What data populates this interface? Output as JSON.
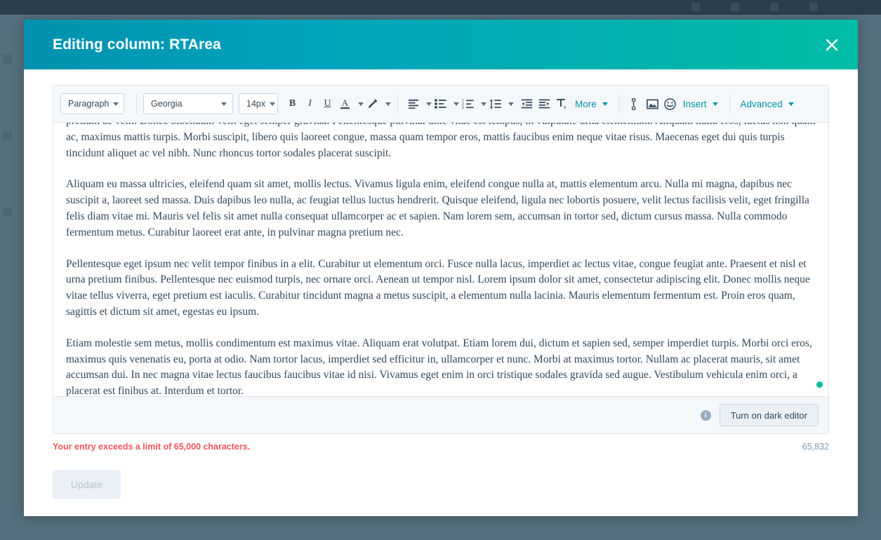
{
  "modal": {
    "title": "Editing column: RTArea",
    "close_label": "close-icon"
  },
  "toolbar": {
    "block_format": "Paragraph",
    "font_family": "Georgia",
    "font_size": "14px",
    "bold": "B",
    "italic": "I",
    "underline": "U",
    "text_color": "A",
    "more": "More",
    "insert": "Insert",
    "advanced": "Advanced",
    "icons": {
      "text_color": "text-color-icon",
      "highlight": "highlight-pen-icon",
      "align": "align-left-icon",
      "bullet_list": "bulleted-list-icon",
      "numbered_list": "numbered-list-icon",
      "line_height": "line-height-icon",
      "outdent": "outdent-icon",
      "indent": "indent-icon",
      "clear_format": "clear-formatting-icon",
      "link": "link-icon",
      "image": "image-icon",
      "emoji": "emoji-icon"
    }
  },
  "document": {
    "paragraphs": [
      "pretium ac velit. Donec bibendum velit eget semper gravida. Pellentesque pulvinar ante vitae est tempus, in vulputate urna elementum. Aliquam nulla eros, luctus non quam ac, maximus mattis turpis. Morbi suscipit, libero quis laoreet congue, massa quam tempor eros, mattis faucibus enim neque vitae risus. Maecenas eget dui quis turpis tincidunt aliquet ac vel nibh. Nunc rhoncus tortor sodales placerat suscipit.",
      "Aliquam eu massa ultricies, eleifend quam sit amet, mollis lectus. Vivamus ligula enim, eleifend congue nulla at, mattis elementum arcu. Nulla mi magna, dapibus nec suscipit a, laoreet sed massa. Duis dapibus leo nulla, ac feugiat tellus luctus hendrerit. Quisque eleifend, ligula nec lobortis posuere, velit lectus facilisis velit, eget fringilla felis diam vitae mi. Mauris vel felis sit amet nulla consequat ullamcorper ac et sapien. Nam lorem sem, accumsan in tortor sed, dictum cursus massa. Nulla commodo fermentum metus. Curabitur laoreet erat ante, in pulvinar magna pretium nec.",
      "Pellentesque eget ipsum nec velit tempor finibus in a elit. Curabitur ut elementum orci. Fusce nulla lacus, imperdiet ac lectus vitae, congue feugiat ante. Praesent et nisl et urna pretium finibus. Pellentesque nec euismod turpis, nec ornare orci. Aenean ut tempor nisl. Lorem ipsum dolor sit amet, consectetur adipiscing elit. Donec mollis neque vitae tellus viverra, eget pretium est iaculis. Curabitur tincidunt magna a metus suscipit, a elementum nulla lacinia. Mauris elementum fermentum est. Proin eros quam, sagittis et dictum sit amet, egestas eu ipsum.",
      "Etiam molestie sem metus, mollis condimentum est maximus vitae. Aliquam erat volutpat. Etiam lorem dui, dictum et sapien sed, semper imperdiet turpis. Morbi orci eros, maximus quis venenatis eu, porta at odio. Nam tortor lacus, imperdiet sed efficitur in, ullamcorper et nunc. Morbi at maximus tortor. Nullam ac placerat mauris, sit amet accumsan dui. In nec magna vitae lectus faucibus faucibus vitae id nisi. Vivamus eget enim in orci tristique sodales gravida sed augue. Vestibulum vehicula enim orci, a placerat est finibus at. Interdum et tortor."
    ],
    "resize_handle": "resize-handle"
  },
  "status_bar": {
    "info_glyph": "i",
    "dark_editor_label": "Turn on dark editor"
  },
  "validation": {
    "error_message": "Your entry exceeds a limit of 65,000 characters.",
    "character_count": "65,832"
  },
  "footer": {
    "update_label": "Update"
  },
  "colors": {
    "header_gradient_start": "#0091ae",
    "header_gradient_end": "#00bda5",
    "error": "#f2545b",
    "link": "#0091ae",
    "status_dot": "#00bda5",
    "overlay": "#56707f"
  }
}
